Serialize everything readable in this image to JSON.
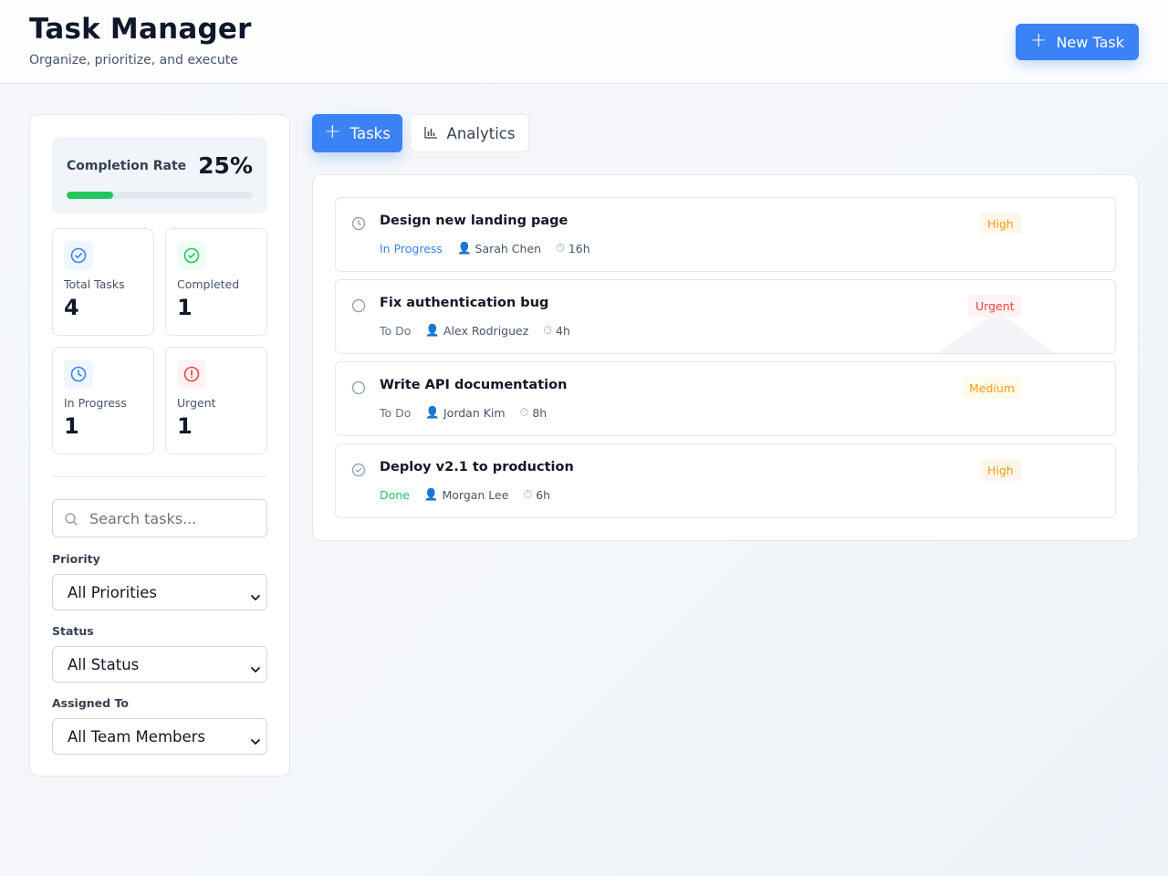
{
  "header": {
    "title": "Task Manager",
    "subtitle": "Organize, prioritize, and execute",
    "new_task_label": "New Task"
  },
  "sidebar": {
    "completion": {
      "label": "Completion Rate",
      "value": "25%",
      "fraction": 0.25
    },
    "stats": [
      {
        "label": "Total Tasks",
        "value": "4",
        "icon": "check-circle-icon"
      },
      {
        "label": "Completed",
        "value": "1",
        "icon": "check-circle-icon"
      },
      {
        "label": "In Progress",
        "value": "1",
        "icon": "clock-icon"
      },
      {
        "label": "Urgent",
        "value": "1",
        "icon": "alert-circle-icon"
      }
    ],
    "search": {
      "placeholder": "Search tasks..."
    },
    "filters": [
      {
        "label": "Priority",
        "selected": "All Priorities"
      },
      {
        "label": "Status",
        "selected": "All Status"
      },
      {
        "label": "Assigned To",
        "selected": "All Team Members"
      }
    ]
  },
  "tabs": [
    {
      "label": "Tasks",
      "icon": "plus-icon",
      "active": true
    },
    {
      "label": "Analytics",
      "icon": "bar-chart-icon",
      "active": false
    }
  ],
  "tasks": [
    {
      "title": "Design new landing page",
      "status": "In Progress",
      "assignee": "Sarah Chen",
      "estimate": "16h",
      "priority": "High"
    },
    {
      "title": "Fix authentication bug",
      "status": "To Do",
      "assignee": "Alex Rodriguez",
      "estimate": "4h",
      "priority": "Urgent"
    },
    {
      "title": "Write API documentation",
      "status": "To Do",
      "assignee": "Jordan Kim",
      "estimate": "8h",
      "priority": "Medium"
    },
    {
      "title": "Deploy v2.1 to production",
      "status": "Done",
      "assignee": "Morgan Lee",
      "estimate": "6h",
      "priority": "High"
    }
  ],
  "colors": {
    "accent": "#3b82f6",
    "success": "#22c55e",
    "in_progress": "#3b82f6",
    "urgent": "#ef4444",
    "high": "#f59e0b",
    "medium": "#f59e0b"
  }
}
